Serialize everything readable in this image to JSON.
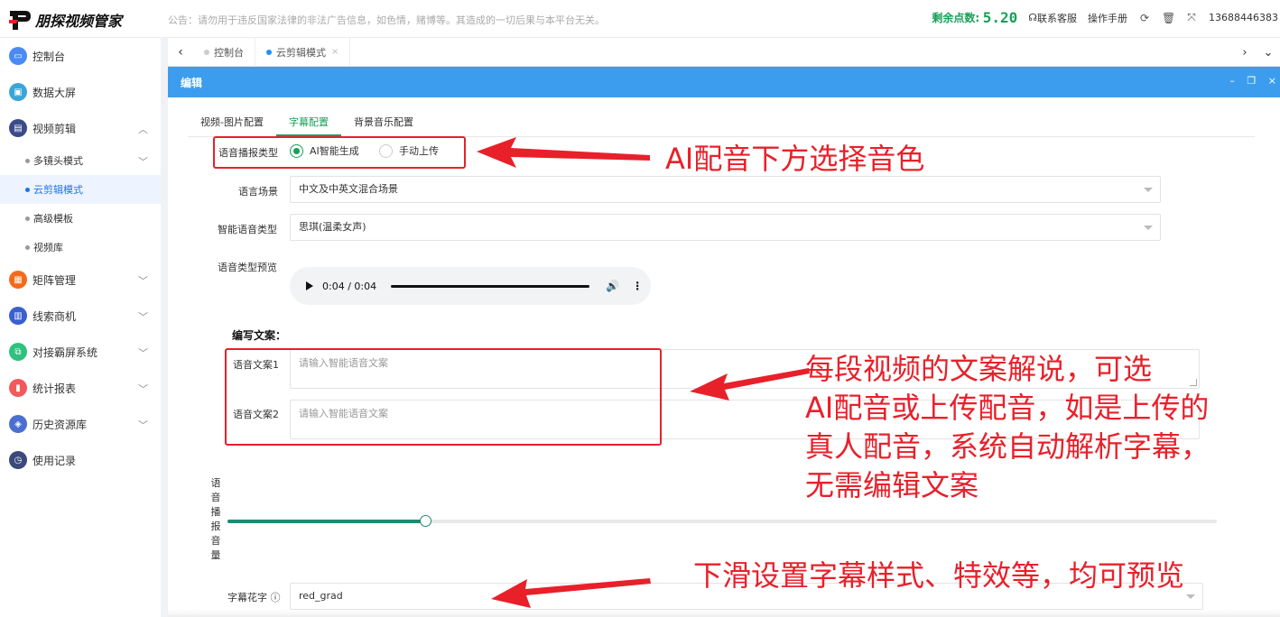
{
  "app": {
    "brand": "朋探视频管家"
  },
  "notice": "公告：请勿用于违反国家法律的非法广告信息，如色情，赌博等。其造成的一切后果与本平台无关。",
  "header": {
    "balance_label": "剩余点数:",
    "balance_value": "5.20",
    "contact": "联系客服",
    "manual": "操作手册",
    "phone": "13688446383"
  },
  "sidebar": {
    "items": [
      {
        "label": "控制台",
        "icon": "monitor-icon",
        "color": "#4a8af4"
      },
      {
        "label": "数据大屏",
        "icon": "screen-icon",
        "color": "#3aa6d8"
      },
      {
        "label": "视频剪辑",
        "icon": "edit-icon",
        "color": "#3a4a8a"
      },
      {
        "label": "矩阵管理",
        "icon": "grid-icon",
        "color": "#f26b1d"
      },
      {
        "label": "线索商机",
        "icon": "chart-icon",
        "color": "#3a5fcf"
      },
      {
        "label": "对接霸屏系统",
        "icon": "link-icon",
        "color": "#2ec27e"
      },
      {
        "label": "统计报表",
        "icon": "stats-icon",
        "color": "#f25a5a"
      },
      {
        "label": "历史资源库",
        "icon": "layers-icon",
        "color": "#4a6fd0"
      },
      {
        "label": "使用记录",
        "icon": "clock-icon",
        "color": "#3a4a7a"
      }
    ],
    "sub": [
      "多镜头模式",
      "云剪辑模式",
      "高级模板",
      "视频库"
    ]
  },
  "tabs": {
    "t1": "控制台",
    "t2": "云剪辑模式"
  },
  "editbar": {
    "title": "编辑"
  },
  "subtabs": [
    "视频-图片配置",
    "字幕配置",
    "背景音乐配置"
  ],
  "form": {
    "voice_type_label": "语音播报类型",
    "radio_ai": "AI智能生成",
    "radio_upload": "手动上传",
    "scene_label": "语言场景",
    "scene_value": "中文及中英文混合场景",
    "voice_label": "智能语音类型",
    "voice_value": "思琪(温柔女声)",
    "preview_label": "语音类型预览",
    "audio_time": "0:04 / 0:04",
    "copy_heading": "编写文案：",
    "copy1_label": "语音文案1",
    "copy2_label": "语音文案2",
    "copy_placeholder": "请输入智能语音文案",
    "volume_label": "语音播报音量",
    "volume_level": 0.2,
    "font_label": "字幕花字 ⓘ",
    "font_value": "red_grad"
  },
  "annotations": {
    "a1": "AI配音下方选择音色",
    "a2_l1": "每段视频的文案解说，可选",
    "a2_l2": "AI配音或上传配音，如是上传的",
    "a2_l3": "真人配音，系统自动解析字幕，",
    "a2_l4": "无需编辑文案",
    "a3": "下滑设置字幕样式、特效等，均可预览"
  }
}
